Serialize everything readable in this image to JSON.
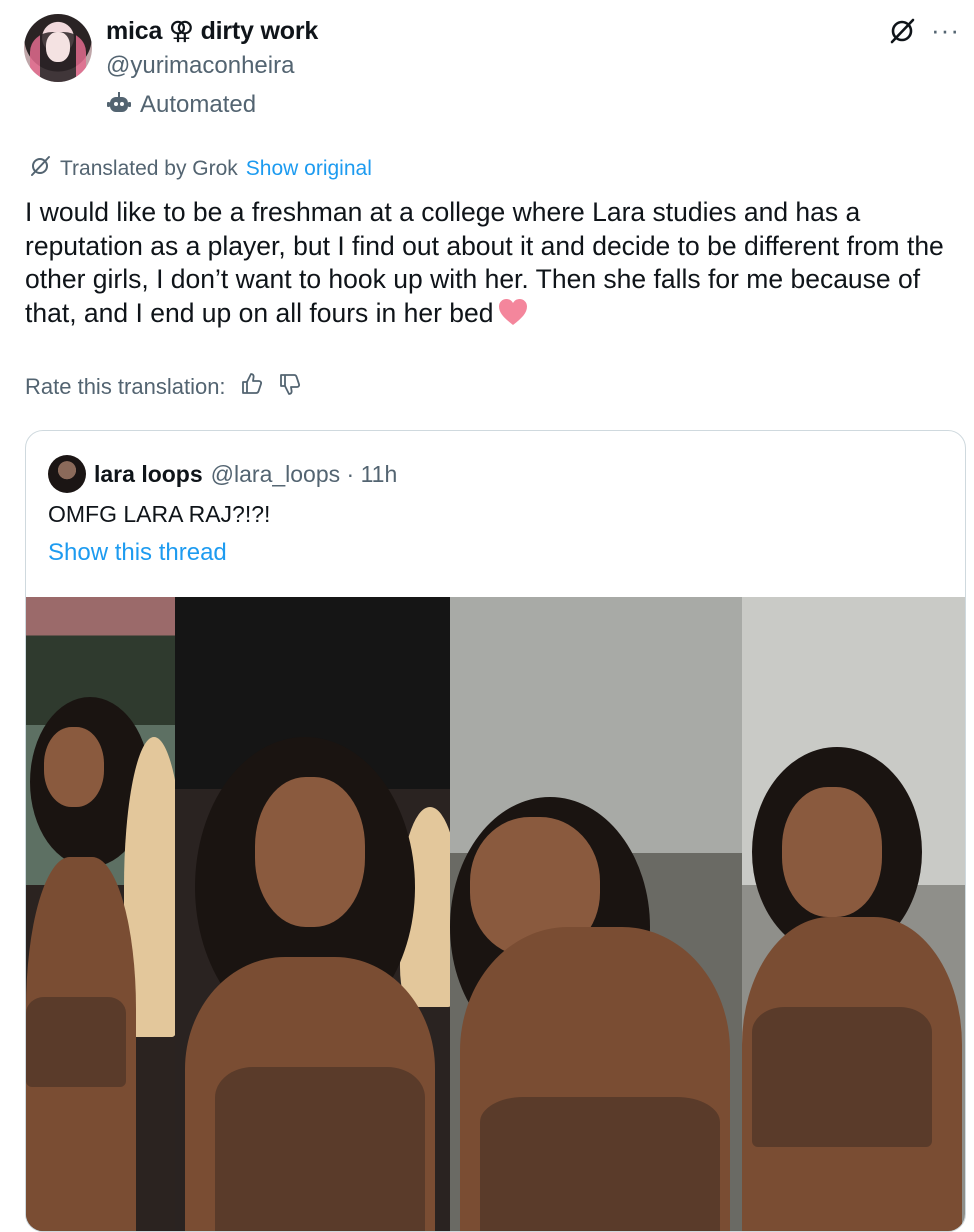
{
  "author": {
    "display_name": "mica ⚢ dirty work",
    "handle": "@yurimaconheira",
    "label": "Automated",
    "label_icon": "bot-icon"
  },
  "top_icons": [
    "grok-icon",
    "more-icon"
  ],
  "more_glyph": "···",
  "translation": {
    "translated_by": "Translated by Grok",
    "show_original": "Show original",
    "rate_label": "Rate this translation:"
  },
  "tweet_text": "I would like to be a freshman at a college where Lara studies and has a reputation as a player, but I find out about it and decide to be different from the other girls, I don’t want to hook up with her. Then she falls for me because of that, and I end up on all fours in her bed",
  "heart_color": "#f4869c",
  "quote": {
    "name": "lara loops",
    "handle": "@lara_loops · 11h",
    "text": "OMFG LARA RAJ?!?!",
    "thread_link": "Show this thread"
  },
  "colors": {
    "link": "#1d9bf0",
    "secondary": "#536471",
    "border": "#cfd9de"
  }
}
